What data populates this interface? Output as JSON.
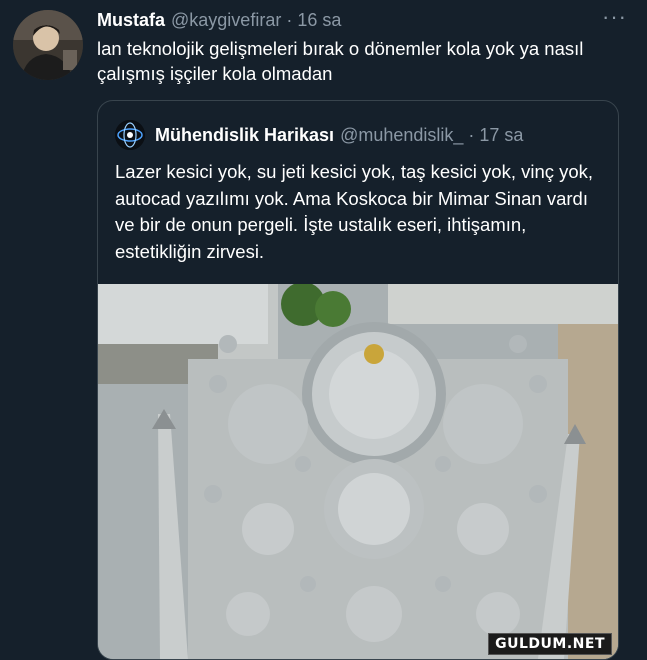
{
  "tweet": {
    "author_name": "Mustafa",
    "author_handle": "@kaygivefirar",
    "separator": "·",
    "time": "16 sa",
    "more_icon": "more-horizontal-icon",
    "text": "lan teknolojik gelişmeleri bırak o dönemler kola yok ya nasıl çalışmış işçiler kola olmadan"
  },
  "quote": {
    "author_name": "Mühendislik Harikası",
    "author_handle": "@muhendislik_",
    "separator": "·",
    "time": "17 sa",
    "text": "Lazer kesici yok, su jeti kesici yok, taş kesici yok, vinç yok, autocad yazılımı yok. Ama Koskoca bir Mimar Sinan vardı ve bir de onun pergeli. İşte ustalık eseri, ihtişamın, estetikliğin zirvesi."
  },
  "watermark": "GULDUM.NET",
  "colors": {
    "background": "#15202b",
    "text": "#ffffff",
    "secondary": "#8b98a5",
    "border": "#38444d"
  }
}
